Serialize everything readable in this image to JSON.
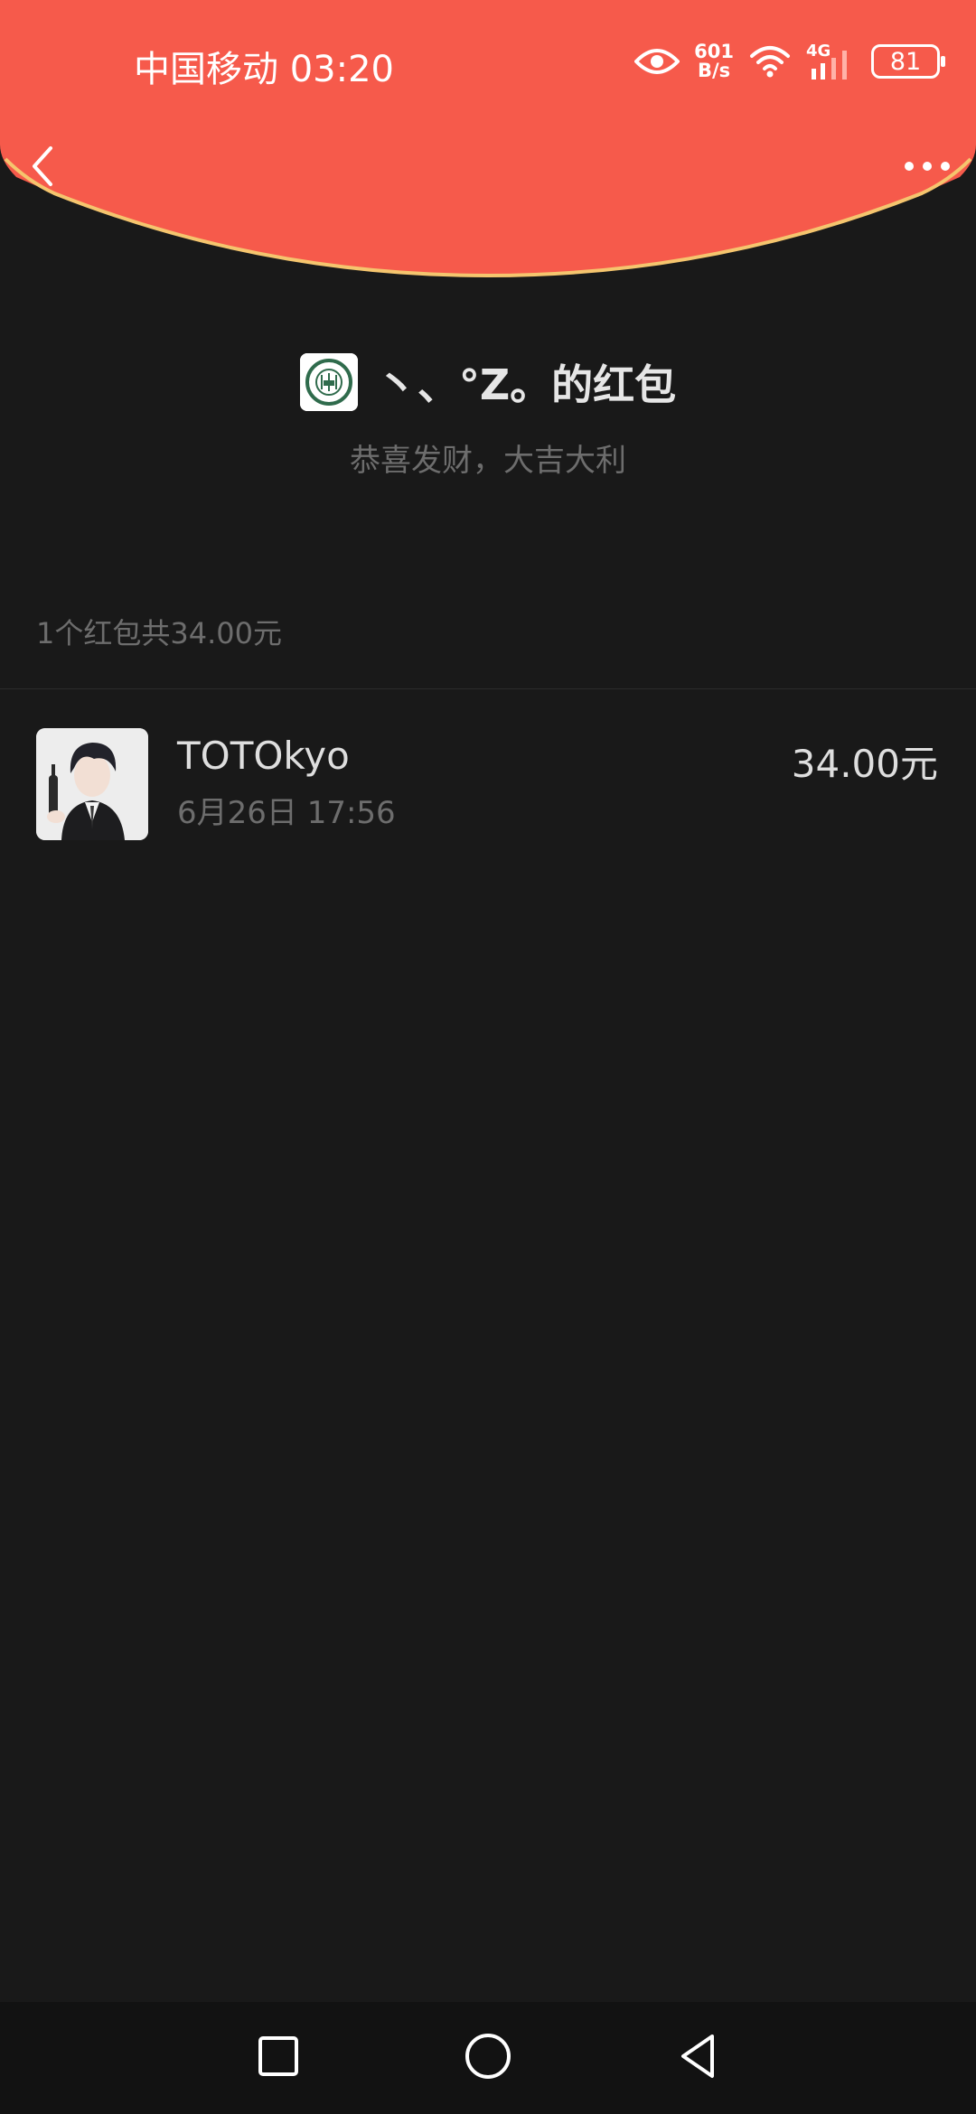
{
  "status_bar": {
    "carrier_time": "中国移动 03:20",
    "net_speed_value": "601",
    "net_speed_unit": "B/s",
    "network_type": "4G",
    "battery": "81"
  },
  "envelope": {
    "sender_title": "丶、°Z。的红包",
    "blessing": "恭喜发财，大吉大利",
    "summary": "1个红包共34.00元"
  },
  "receivers": [
    {
      "name": "TOTOkyo",
      "time": "6月26日  17:56",
      "amount": "34.00元"
    }
  ],
  "colors": {
    "header_red": "#f65a4b",
    "header_edge": "#f5c56e",
    "background": "#191919"
  }
}
